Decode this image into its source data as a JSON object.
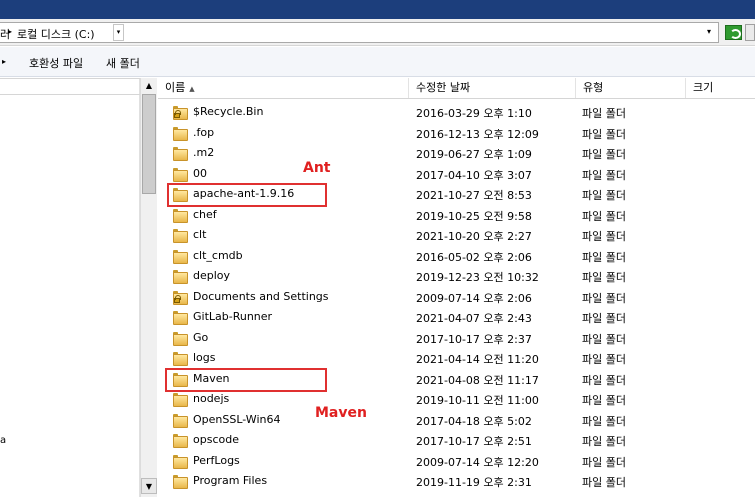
{
  "address": {
    "crumb_cut": "러",
    "crumb_separator": "▸",
    "drive": "로컬 디스크 (C:)",
    "drive_dropdown": "▾",
    "dropdown": "▾"
  },
  "toolbar": {
    "arrow": "▸",
    "compat_files": "호환성 파일",
    "new_folder": "새 폴더"
  },
  "left_pane": {
    "glyph": "a"
  },
  "scrollbar": {
    "up": "▲",
    "down": "▼"
  },
  "columns": {
    "name": "이름",
    "sort_indicator": "▲",
    "date": "수정한 날짜",
    "type": "유형",
    "size": "크기"
  },
  "files": [
    {
      "name": "$Recycle.Bin",
      "date": "2016-03-29 오후 1:10",
      "type": "파일 폴더",
      "locked": true
    },
    {
      "name": ".fop",
      "date": "2016-12-13 오후 12:09",
      "type": "파일 폴더",
      "locked": false
    },
    {
      "name": ".m2",
      "date": "2019-06-27 오후 1:09",
      "type": "파일 폴더",
      "locked": false
    },
    {
      "name": "00",
      "date": "2017-04-10 오후 3:07",
      "type": "파일 폴더",
      "locked": false
    },
    {
      "name": "apache-ant-1.9.16",
      "date": "2021-10-27 오전 8:53",
      "type": "파일 폴더",
      "locked": false
    },
    {
      "name": "chef",
      "date": "2019-10-25 오전 9:58",
      "type": "파일 폴더",
      "locked": false
    },
    {
      "name": "clt",
      "date": "2021-10-20 오후 2:27",
      "type": "파일 폴더",
      "locked": false
    },
    {
      "name": "clt_cmdb",
      "date": "2016-05-02 오후 2:06",
      "type": "파일 폴더",
      "locked": false
    },
    {
      "name": "deploy",
      "date": "2019-12-23 오전 10:32",
      "type": "파일 폴더",
      "locked": false
    },
    {
      "name": "Documents and Settings",
      "date": "2009-07-14 오후 2:06",
      "type": "파일 폴더",
      "locked": true
    },
    {
      "name": "GitLab-Runner",
      "date": "2021-04-07 오후 2:43",
      "type": "파일 폴더",
      "locked": false
    },
    {
      "name": "Go",
      "date": "2017-10-17 오후 2:37",
      "type": "파일 폴더",
      "locked": false
    },
    {
      "name": "logs",
      "date": "2021-04-14 오전 11:20",
      "type": "파일 폴더",
      "locked": false
    },
    {
      "name": "Maven",
      "date": "2021-04-08 오전 11:17",
      "type": "파일 폴더",
      "locked": false
    },
    {
      "name": "nodejs",
      "date": "2019-10-11 오전 11:00",
      "type": "파일 폴더",
      "locked": false
    },
    {
      "name": "OpenSSL-Win64",
      "date": "2017-04-18 오후 5:02",
      "type": "파일 폴더",
      "locked": false
    },
    {
      "name": "opscode",
      "date": "2017-10-17 오후 2:51",
      "type": "파일 폴더",
      "locked": false
    },
    {
      "name": "PerfLogs",
      "date": "2009-07-14 오후 12:20",
      "type": "파일 폴더",
      "locked": false
    },
    {
      "name": "Program Files",
      "date": "2019-11-19 오후 2:31",
      "type": "파일 폴더",
      "locked": false
    }
  ],
  "annotations": {
    "ant_label": "Ant",
    "maven_label": "Maven",
    "color": "#e02020"
  },
  "colors": {
    "titlebar": "#1c3e7c",
    "folder": "#e8b74a",
    "annotation": "#e02020"
  }
}
